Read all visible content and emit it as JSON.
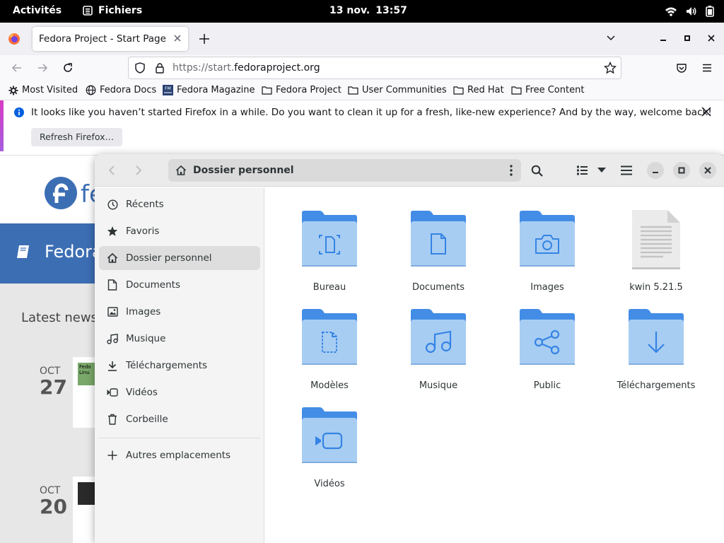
{
  "topbar": {
    "activities": "Activités",
    "app_name": "Fichiers",
    "date": "13 nov.",
    "time": "13:57"
  },
  "browser": {
    "tab_title": "Fedora Project - Start Page",
    "url_prefix": "https://start.",
    "url_domain": "fedoraproject.org",
    "bookmarks": [
      {
        "label": "Most Visited",
        "icon": "gear-icon"
      },
      {
        "label": "Fedora Docs",
        "icon": "globe-icon"
      },
      {
        "label": "Fedora Magazine",
        "icon": "fedora-magazine-icon"
      },
      {
        "label": "Fedora Project",
        "icon": "folder-icon"
      },
      {
        "label": "User Communities",
        "icon": "folder-icon"
      },
      {
        "label": "Red Hat",
        "icon": "folder-icon"
      },
      {
        "label": "Free Content",
        "icon": "folder-icon"
      }
    ],
    "infobar": {
      "message": "It looks like you haven’t started Firefox in a while. Do you want to clean it up for a fresh, like-new experience? And by the way, welcome back!",
      "button": "Refresh Firefox…"
    }
  },
  "webpage": {
    "logo_text": "fe",
    "banner_title": "Fedora",
    "latest_news": "Latest news",
    "news": [
      {
        "month": "OCT",
        "day": "27",
        "thumb_text": "Fedo Linu"
      },
      {
        "month": "OCT",
        "day": "20",
        "thumb_text": ""
      }
    ]
  },
  "files": {
    "path_label": "Dossier personnel",
    "sidebar": [
      {
        "label": "Récents",
        "icon": "clock-icon"
      },
      {
        "label": "Favoris",
        "icon": "star-icon"
      },
      {
        "label": "Dossier personnel",
        "icon": "home-icon",
        "active": true
      },
      {
        "label": "Documents",
        "icon": "document-icon"
      },
      {
        "label": "Images",
        "icon": "image-icon"
      },
      {
        "label": "Musique",
        "icon": "music-icon"
      },
      {
        "label": "Téléchargements",
        "icon": "download-icon"
      },
      {
        "label": "Vidéos",
        "icon": "video-icon"
      },
      {
        "label": "Corbeille",
        "icon": "trash-icon"
      }
    ],
    "other_locations": "Autres emplacements",
    "items": [
      {
        "name": "Bureau",
        "kind": "desktop"
      },
      {
        "name": "Documents",
        "kind": "documents"
      },
      {
        "name": "Images",
        "kind": "pictures"
      },
      {
        "name": "kwin 5.21.5",
        "kind": "textfile"
      },
      {
        "name": "Modèles",
        "kind": "templates"
      },
      {
        "name": "Musique",
        "kind": "music"
      },
      {
        "name": "Public",
        "kind": "public"
      },
      {
        "name": "Téléchargements",
        "kind": "downloads"
      },
      {
        "name": "Vidéos",
        "kind": "videos"
      }
    ]
  },
  "colors": {
    "folder_top": "#438de6",
    "folder_body": "#a8cdf3",
    "folder_glyph": "#3584e4",
    "fedora_blue": "#3c6eb4",
    "firefox_orange": "#ff7139"
  }
}
